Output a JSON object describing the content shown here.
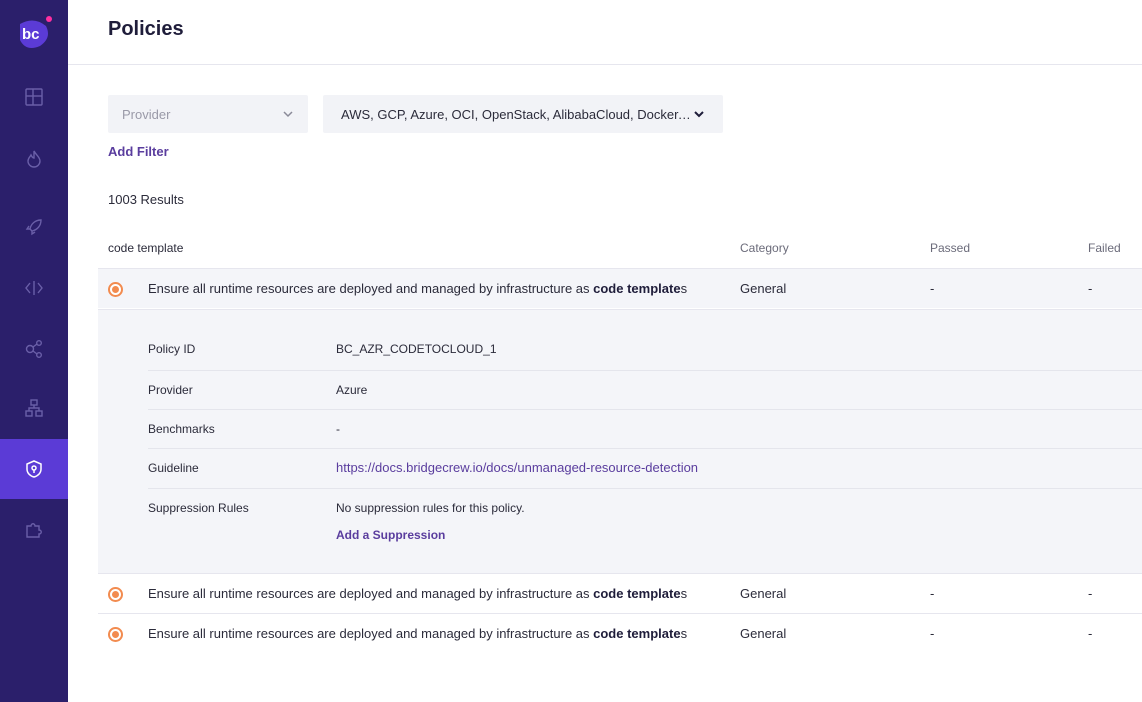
{
  "header": {
    "title": "Policies"
  },
  "filters": {
    "provider_placeholder": "Provider",
    "clouds_value": "AWS, GCP, Azure, OCI, OpenStack, AlibabaCloud, Docker, Kubernetes",
    "add_filter": "Add Filter"
  },
  "results": {
    "count_label": "1003 Results"
  },
  "table": {
    "columns": {
      "name": "code template",
      "category": "Category",
      "passed": "Passed",
      "failed": "Failed"
    },
    "rows": [
      {
        "name_pre": "Ensure all runtime resources are deployed and managed by infrastructure as ",
        "name_bold": "code template",
        "name_post": "s",
        "category": "General",
        "passed": "-",
        "failed": "-"
      },
      {
        "name_pre": "Ensure all runtime resources are deployed and managed by infrastructure as ",
        "name_bold": "code template",
        "name_post": "s",
        "category": "General",
        "passed": "-",
        "failed": "-"
      },
      {
        "name_pre": "Ensure all runtime resources are deployed and managed by infrastructure as ",
        "name_bold": "code template",
        "name_post": "s",
        "category": "General",
        "passed": "-",
        "failed": "-"
      }
    ]
  },
  "details": {
    "policy_id_label": "Policy ID",
    "policy_id": "BC_AZR_CODETOCLOUD_1",
    "provider_label": "Provider",
    "provider": "Azure",
    "benchmarks_label": "Benchmarks",
    "benchmarks": "-",
    "guideline_label": "Guideline",
    "guideline": "https://docs.bridgecrew.io/docs/unmanaged-resource-detection",
    "suppression_label": "Suppression Rules",
    "suppression": "No suppression rules for this policy.",
    "add_suppression": "Add a Suppression"
  },
  "colors": {
    "sidebar": "#2b1f6b",
    "active": "#5b3bd6",
    "accent": "#5a3d9e",
    "severity": "#f28b4f"
  },
  "sidebar": {
    "icons": [
      "dashboard-icon",
      "flame-icon",
      "rocket-icon",
      "code-icon",
      "graph-icon",
      "hierarchy-icon",
      "shield-icon",
      "puzzle-icon"
    ],
    "active": "shield-icon"
  }
}
